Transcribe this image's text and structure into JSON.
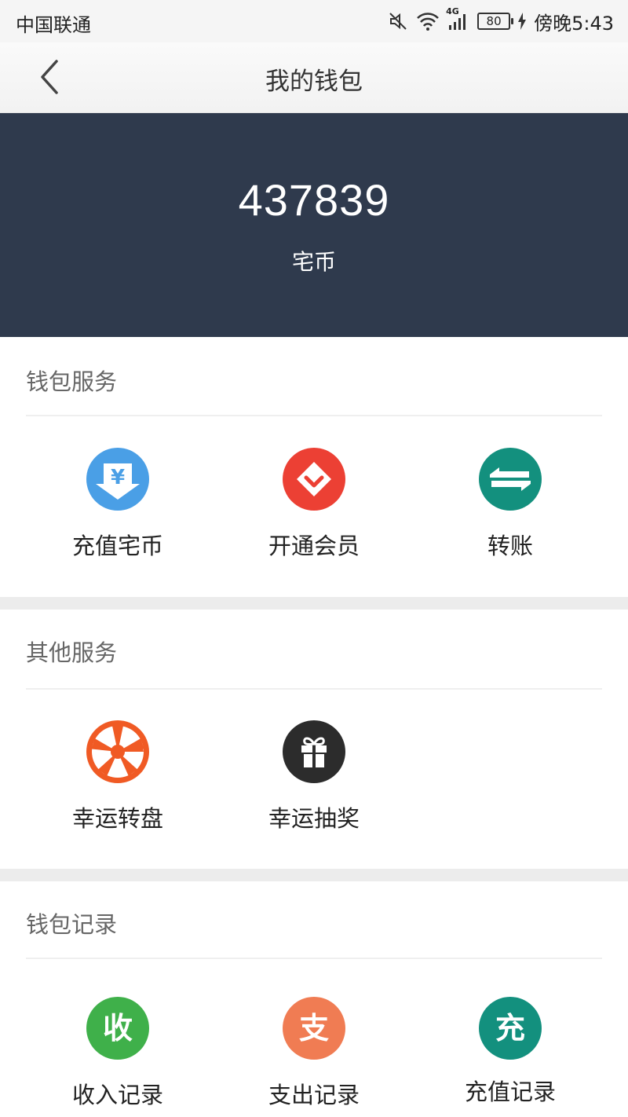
{
  "status_bar": {
    "carrier": "中国联通",
    "network": "4G",
    "battery": "80",
    "time": "傍晚5:43"
  },
  "header": {
    "title": "我的钱包"
  },
  "balance": {
    "amount": "437839",
    "unit": "宅币"
  },
  "sections": {
    "wallet_services": {
      "title": "钱包服务",
      "items": [
        {
          "label": "充值宅币",
          "icon": "yuan-download-icon",
          "color": "#4a9fe6"
        },
        {
          "label": "开通会员",
          "icon": "vip-diamond-icon",
          "color": "#ec4034"
        },
        {
          "label": "转账",
          "icon": "transfer-arrows-icon",
          "color": "#13907e"
        }
      ]
    },
    "other_services": {
      "title": "其他服务",
      "items": [
        {
          "label": "幸运转盘",
          "icon": "wheel-icon",
          "color": "#f05a24"
        },
        {
          "label": "幸运抽奖",
          "icon": "gift-icon",
          "color": "#2c2c2c"
        }
      ]
    },
    "wallet_records": {
      "title": "钱包记录",
      "items": [
        {
          "label": "收入记录",
          "icon_char": "收",
          "color": "#3fb04a"
        },
        {
          "label": "支出记录",
          "icon_char": "支",
          "color": "#f07c53"
        },
        {
          "label": "充值记录",
          "icon_char": "充",
          "color": "#13907e"
        }
      ]
    }
  },
  "colors": {
    "header_bg": "#2f3a4d",
    "page_bg": "#ffffff",
    "separator": "#ececec"
  }
}
